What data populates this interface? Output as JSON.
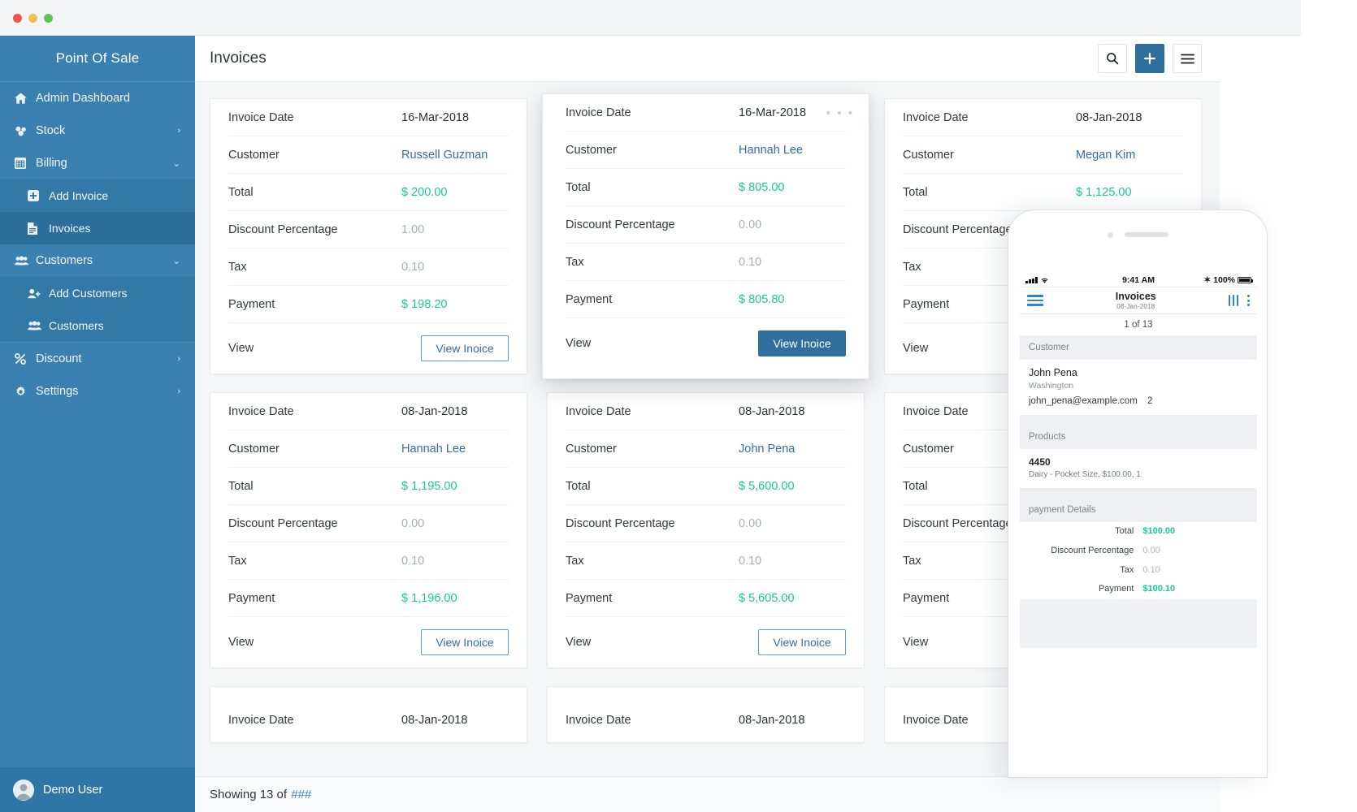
{
  "window": {
    "dots": [
      "close",
      "minimize",
      "maximize"
    ]
  },
  "sidebar": {
    "brand": "Point Of Sale",
    "items": [
      {
        "label": "Admin Dashboard",
        "icon": "home-icon",
        "caret": "",
        "state": "normal"
      },
      {
        "label": "Stock",
        "icon": "stock-icon",
        "caret": "›",
        "state": "normal"
      },
      {
        "label": "Billing",
        "icon": "billing-icon",
        "caret": "⌄",
        "state": "group-open"
      },
      {
        "label": "Add Invoice",
        "icon": "plus-square-icon",
        "caret": "",
        "state": "child"
      },
      {
        "label": "Invoices",
        "icon": "document-icon",
        "caret": "",
        "state": "active"
      },
      {
        "label": "Customers",
        "icon": "users-icon",
        "caret": "⌄",
        "state": "group-open"
      },
      {
        "label": "Add Customers",
        "icon": "user-plus-icon",
        "caret": "",
        "state": "child"
      },
      {
        "label": "Customers",
        "icon": "users-icon",
        "caret": "",
        "state": "child"
      },
      {
        "label": "Discount",
        "icon": "percent-icon",
        "caret": "›",
        "state": "normal"
      },
      {
        "label": "Settings",
        "icon": "gear-icon",
        "caret": "›",
        "state": "normal"
      }
    ],
    "user": {
      "name": "Demo User",
      "avatar": "avatar-icon"
    }
  },
  "topbar": {
    "title": "Invoices",
    "search_icon": "search-icon",
    "add_icon": "plus-icon",
    "menu_icon": "hamburger-icon"
  },
  "labels": {
    "invoice_date": "Invoice Date",
    "customer": "Customer",
    "total": "Total",
    "discount": "Discount Percentage",
    "tax": "Tax",
    "payment": "Payment",
    "view": "View",
    "view_button": "View Inoice",
    "dots": "• • •"
  },
  "cards": [
    {
      "date": "16-Mar-2018",
      "customer": "Russell Guzman",
      "total": "$ 200.00",
      "discount": "1.00",
      "tax": "0.10",
      "payment": "$ 198.20",
      "elevated": false
    },
    {
      "date": "16-Mar-2018",
      "customer": "Hannah Lee",
      "total": "$ 805.00",
      "discount": "0.00",
      "tax": "0.10",
      "payment": "$ 805.80",
      "elevated": true
    },
    {
      "date": "08-Jan-2018",
      "customer": "Megan Kim",
      "total": "$ 1,125.00",
      "discount": "",
      "tax": "",
      "payment": "",
      "elevated": false
    },
    {
      "date": "08-Jan-2018",
      "customer": "Hannah Lee",
      "total": "$ 1,195.00",
      "discount": "0.00",
      "tax": "0.10",
      "payment": "$ 1,196.00",
      "elevated": false
    },
    {
      "date": "08-Jan-2018",
      "customer": "John Pena",
      "total": "$ 5,600.00",
      "discount": "0.00",
      "tax": "0.10",
      "payment": "$ 5,605.00",
      "elevated": false
    },
    {
      "date": "",
      "customer": "",
      "total": "",
      "discount": "",
      "tax": "",
      "payment": "",
      "elevated": false
    }
  ],
  "partial_row": [
    {
      "date": "08-Jan-2018"
    },
    {
      "date": "08-Jan-2018"
    },
    {
      "date": ""
    }
  ],
  "status": {
    "prefix": "Showing 13 of",
    "hash": "###"
  },
  "phone": {
    "ios": {
      "time": "9:41 AM",
      "battery": "100%",
      "bluetooth": "✶"
    },
    "nav": {
      "menu_icon": "hamburger-icon",
      "title": "Invoices",
      "subtitle": "08-Jan-2018",
      "filter_icon": "sliders-icon",
      "more_icon": "kebab-icon"
    },
    "count": "1 of 13",
    "sections": {
      "customer_header": "Customer",
      "customer_name": "John Pena",
      "customer_city": "Washington",
      "customer_email": "john_pena@example.com",
      "customer_badge": "2",
      "products_header": "Products",
      "product_sku": "4450",
      "product_desc": "Dairy - Pocket Size, $100.00, 1",
      "payment_header": "payment Details"
    },
    "payment_rows": [
      {
        "k": "Total",
        "v": "$100.00",
        "kind": "g"
      },
      {
        "k": "Discount Percentage",
        "v": "0.00",
        "kind": "m"
      },
      {
        "k": "Tax",
        "v": "0.10",
        "kind": "m"
      },
      {
        "k": "Payment",
        "v": "$100.10",
        "kind": "g"
      }
    ]
  },
  "colors": {
    "sidebar": "#3a80b0",
    "sidebar_active": "#2b6d9b",
    "primary": "#2e6f9e",
    "link": "#2f6fa8",
    "money": "#17c79a",
    "muted": "#a8aeb4"
  }
}
